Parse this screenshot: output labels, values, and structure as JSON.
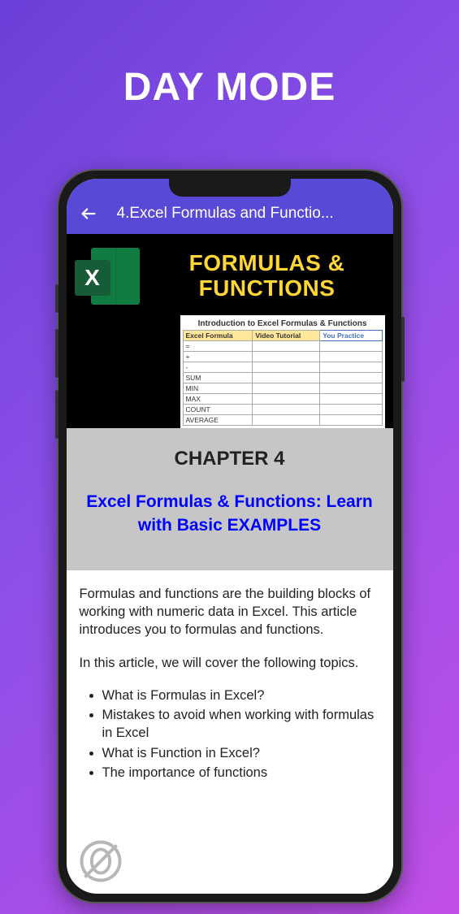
{
  "page_title": "DAY MODE",
  "appbar": {
    "title": "4.Excel Formulas and Functio..."
  },
  "banner": {
    "heading": "FORMULAS & FUNCTIONS",
    "excel_letter": "X",
    "spreadsheet": {
      "title": "Introduction to Excel Formulas & Functions",
      "headers": [
        "Excel Formula",
        "Video Tutorial",
        "You Practice"
      ],
      "rows": [
        "=",
        "+",
        "-",
        "SUM",
        "MIN",
        "MAX",
        "COUNT",
        "AVERAGE"
      ]
    }
  },
  "chapter": {
    "label": "CHAPTER 4",
    "title": "Excel Formulas & Functions: Learn with Basic EXAMPLES"
  },
  "article": {
    "intro": "Formulas and functions are the building blocks of working with numeric data in Excel. This article introduces you to formulas and functions.",
    "topics_lead": "In this article, we will cover the following topics.",
    "bullets": [
      "What is Formulas in Excel?",
      "Mistakes to avoid when working with formulas in Excel",
      "What is Function in Excel?",
      "The importance of functions"
    ]
  }
}
